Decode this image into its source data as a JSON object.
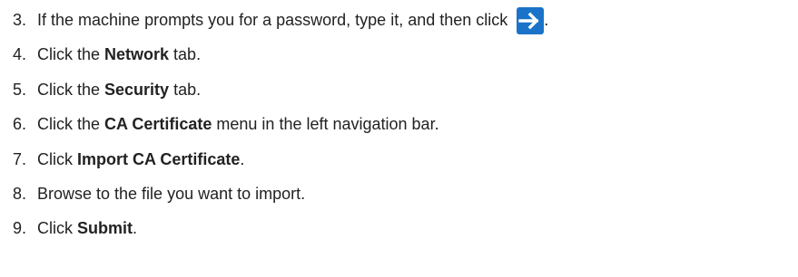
{
  "steps": [
    {
      "number": "3.",
      "parts": [
        {
          "text": "If the machine prompts you for a password, type it, and then click ",
          "bold": false
        }
      ],
      "icon": "arrow-right-icon",
      "after_icon": "."
    },
    {
      "number": "4.",
      "parts": [
        {
          "text": "Click the ",
          "bold": false
        },
        {
          "text": "Network",
          "bold": true
        },
        {
          "text": " tab.",
          "bold": false
        }
      ]
    },
    {
      "number": "5.",
      "parts": [
        {
          "text": "Click the ",
          "bold": false
        },
        {
          "text": "Security",
          "bold": true
        },
        {
          "text": " tab.",
          "bold": false
        }
      ]
    },
    {
      "number": "6.",
      "parts": [
        {
          "text": "Click the ",
          "bold": false
        },
        {
          "text": "CA Certificate",
          "bold": true
        },
        {
          "text": " menu in the left navigation bar.",
          "bold": false
        }
      ]
    },
    {
      "number": "7.",
      "parts": [
        {
          "text": "Click ",
          "bold": false
        },
        {
          "text": "Import CA Certificate",
          "bold": true
        },
        {
          "text": ".",
          "bold": false
        }
      ]
    },
    {
      "number": "8.",
      "parts": [
        {
          "text": "Browse to the file you want to import.",
          "bold": false
        }
      ]
    },
    {
      "number": "9.",
      "parts": [
        {
          "text": "Click ",
          "bold": false
        },
        {
          "text": "Submit",
          "bold": true
        },
        {
          "text": ".",
          "bold": false
        }
      ]
    }
  ],
  "colors": {
    "text": "#222222",
    "icon_background": "#1a73c9",
    "icon_arrow": "#ffffff"
  }
}
